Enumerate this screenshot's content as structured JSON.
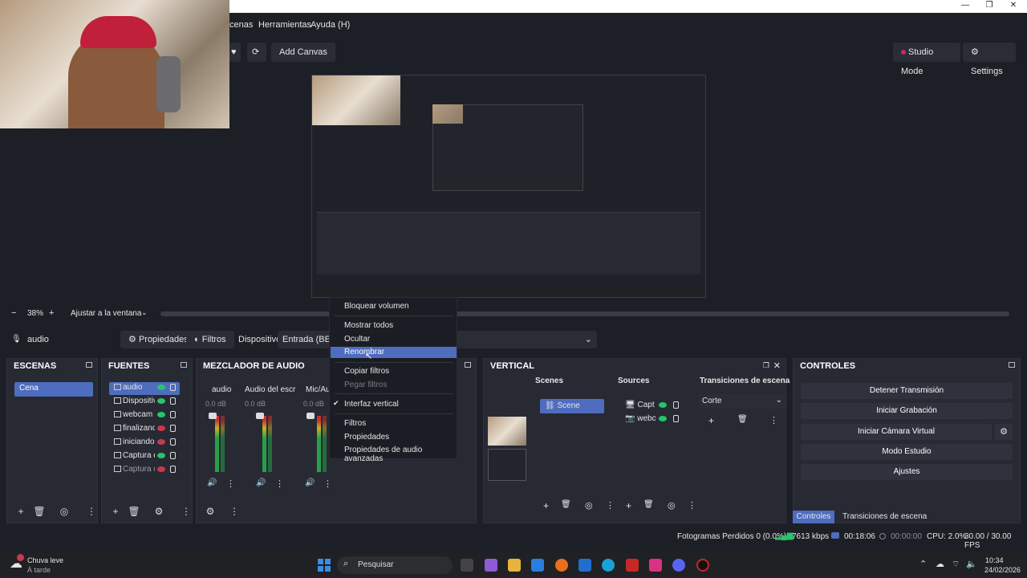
{
  "window": {
    "min": "—",
    "restore": "❐",
    "close": "✕"
  },
  "menu": {
    "items": [
      "cenas",
      "Herramientas",
      "Ayuda (H)"
    ]
  },
  "toolbar": {
    "add_canvas": "Add Canvas",
    "studio_mode": "Studio Mode",
    "settings": "Settings"
  },
  "zoom": {
    "minus": "−",
    "value": "38%",
    "plus": "+",
    "fit": "Ajustar a la ventana"
  },
  "source_bar": {
    "name": "audio",
    "properties": "Propiedades",
    "filters": "Filtros",
    "device_label": "Dispositivo",
    "device_value": "Entrada (BEHR"
  },
  "scenes": {
    "title": "ESCENAS",
    "items": [
      "Cena"
    ]
  },
  "sources": {
    "title": "FUENTES",
    "items": [
      {
        "name": "audio",
        "visible": true
      },
      {
        "name": "Dispositivo",
        "visible": true
      },
      {
        "name": "webcam",
        "visible": true
      },
      {
        "name": "finalizando",
        "visible": false
      },
      {
        "name": "iniciando s",
        "visible": false
      },
      {
        "name": "Captura de",
        "visible": true
      },
      {
        "name": "Captura de",
        "visible": false
      }
    ]
  },
  "mixer": {
    "title": "MEZCLADOR DE AUDIO",
    "channels": [
      {
        "name": "audio",
        "db": "0.0 dB"
      },
      {
        "name": "Audio del escrito",
        "db": "0.0 dB"
      },
      {
        "name": "Mic/Au",
        "db": "0.0 dB"
      }
    ],
    "scale": [
      "0",
      "-5",
      "-10",
      "-15",
      "-20",
      "-25",
      "-30",
      "-35",
      "-40",
      "-45",
      "-50",
      "-55",
      "-60"
    ]
  },
  "context_menu": {
    "items": [
      {
        "label": "Bloquear volumen"
      },
      {
        "label": "Mostrar todos"
      },
      {
        "label": "Ocultar"
      },
      {
        "label": "Renombrar",
        "selected": true
      },
      {
        "label": "Copiar filtros"
      },
      {
        "label": "Pegar filtros",
        "disabled": true
      },
      {
        "label": "Interfaz vertical",
        "checked": true
      },
      {
        "label": "Filtros"
      },
      {
        "label": "Propiedades"
      },
      {
        "label": "Propiedades de audio avanzadas"
      }
    ]
  },
  "vertical": {
    "title": "VERTICAL",
    "scenes_label": "Scenes",
    "scene_item": "Scene",
    "sources_label": "Sources",
    "sources": [
      "Capt",
      "webc"
    ],
    "transitions_label": "Transiciones de escena",
    "transition_value": "Corte"
  },
  "controls": {
    "title": "CONTROLES",
    "buttons": [
      "Detener Transmisión",
      "Iniciar Grabación",
      "Iniciar Cámara Virtual",
      "Modo Estudio",
      "Ajustes"
    ],
    "tabs": [
      "Controles",
      "Transiciones de escena"
    ]
  },
  "status": {
    "dropped": "Fotogramas Perdidos 0 (0.0%)",
    "bitrate": "7613 kbps",
    "stream_time": "00:18:06",
    "rec_time": "00:00:00",
    "cpu": "CPU: 2.0%",
    "fps": "30.00 / 30.00 FPS"
  },
  "taskbar": {
    "weather_title": "Chuva leve",
    "weather_sub": "À tarde",
    "search": "Pesquisar",
    "time": "10:34",
    "date": "24/02/2026"
  },
  "colors": {
    "accent": "#4f6dbf",
    "live_green": "#27c46b",
    "hidden_red": "#c93a4a",
    "rec_dot": "#c8286a"
  }
}
